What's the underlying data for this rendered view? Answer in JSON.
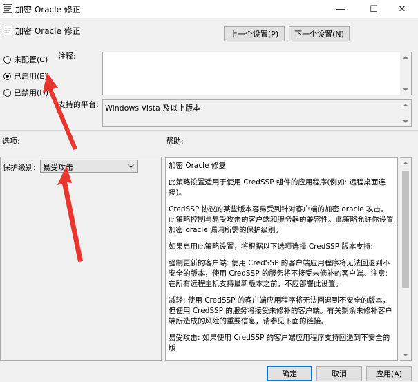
{
  "window": {
    "title": "加密 Oracle 修正",
    "minimize_glyph": "—",
    "maximize_glyph": "☐",
    "close_glyph": "✕"
  },
  "header": {
    "policy_name": "加密 Oracle 修正",
    "icon": "policy-icon"
  },
  "nav": {
    "prev_label": "上一个设置(P)",
    "next_label": "下一个设置(N)"
  },
  "state": {
    "options": [
      {
        "label": "未配置(C)",
        "selected": false
      },
      {
        "label": "已启用(E)",
        "selected": true
      },
      {
        "label": "已禁用(D)",
        "selected": false
      }
    ]
  },
  "comment": {
    "label": "注释:",
    "value": ""
  },
  "supported": {
    "label": "支持的平台:",
    "value": "Windows Vista 及以上版本"
  },
  "options_section": {
    "label": "选项:",
    "protection_label": "保护级别:",
    "protection_value": "易受攻击"
  },
  "help_section": {
    "label": "帮助:",
    "paragraphs": [
      "加密 Oracle 修复",
      "此策略设置适用于使用 CredSSP 组件的应用程序(例如: 远程桌面连接)。",
      "CredSSP 协议的某些版本容易受到针对客户端的加密 oracle 攻击。此策略控制与易受攻击的客户端和服务器的兼容性。此策略允许你设置加密 oracle 漏洞所需的保护级别。",
      "如果启用此策略设置，将根据以下选项选择 CredSSP 版本支持:",
      "强制更新的客户端: 使用 CredSSP 的客户端应用程序将无法回退到不安全的版本，使用 CredSSP 的服务将不接受未修补的客户端。注意: 在所有远程主机支持最新版本之前，不应部署此设置。",
      "减轻: 使用 CredSSP 的客户端应用程序将无法回退到不安全的版本，但使用 CredSSP 的服务将接受未修补的客户端。有关剩余未修补客户端所造成的风险的重要信息，请参见下面的链接。",
      "易受攻击: 如果使用 CredSSP 的客户端应用程序支持回退到不安全的版"
    ]
  },
  "footer": {
    "ok_label": "确定",
    "cancel_label": "取消",
    "apply_label": "应用(A)"
  },
  "colors": {
    "annotation_arrow": "#e8362f",
    "primary_button_border": "#0078d7"
  }
}
